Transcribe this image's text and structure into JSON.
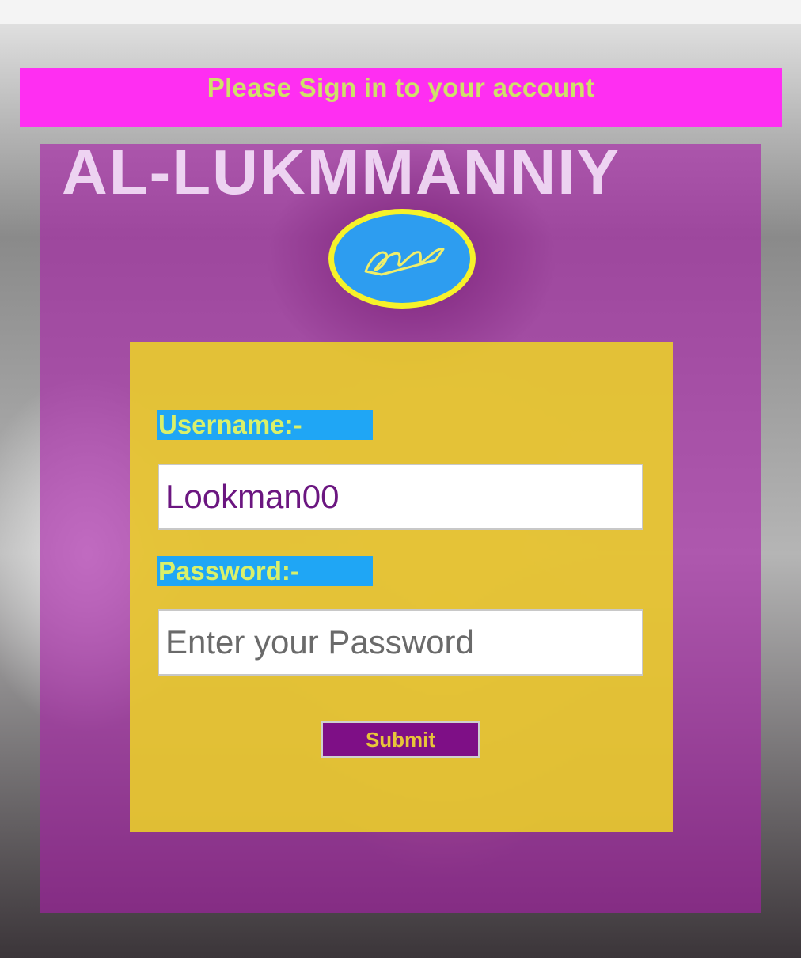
{
  "header": {
    "title": "Please Sign in to your account"
  },
  "brand": {
    "name": "AL-LUKMMANNIY"
  },
  "logo": {
    "icon": "signature-logo-icon"
  },
  "form": {
    "username_label": "Username:-",
    "username_value": "Lookman00",
    "password_label": "Password:-",
    "password_placeholder": "Enter your Password",
    "password_value": "",
    "submit_label": "Submit"
  },
  "colors": {
    "header_bg": "#ff2ef2",
    "header_text": "#cfe06a",
    "card_overlay": "#aa1eaa",
    "form_panel": "#ecd228",
    "label_bg": "#1fa6f5",
    "submit_bg": "#7e0f86",
    "logo_bg": "#2d9df0",
    "logo_ring": "#f6f22a"
  }
}
